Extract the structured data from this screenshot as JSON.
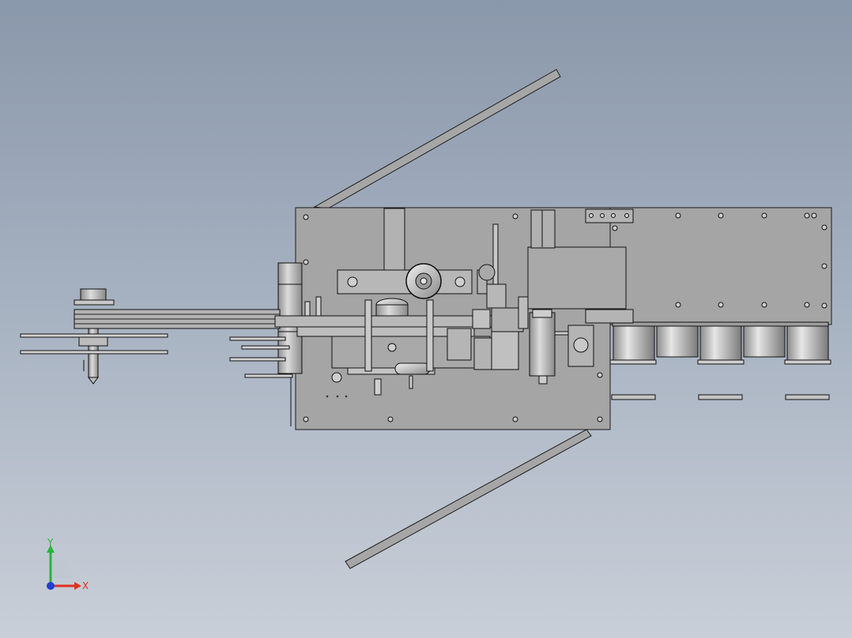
{
  "viewport": {
    "background_top": "#8a98ab",
    "background_bottom": "#c9cfd8",
    "part_fill": "#a3a3a3",
    "part_stroke": "#1a1a1a"
  },
  "triad": {
    "x_label": "X",
    "y_label": "Y",
    "x_color": "#e0301e",
    "y_color": "#27b43c",
    "z_color": "#1f3fd0"
  }
}
